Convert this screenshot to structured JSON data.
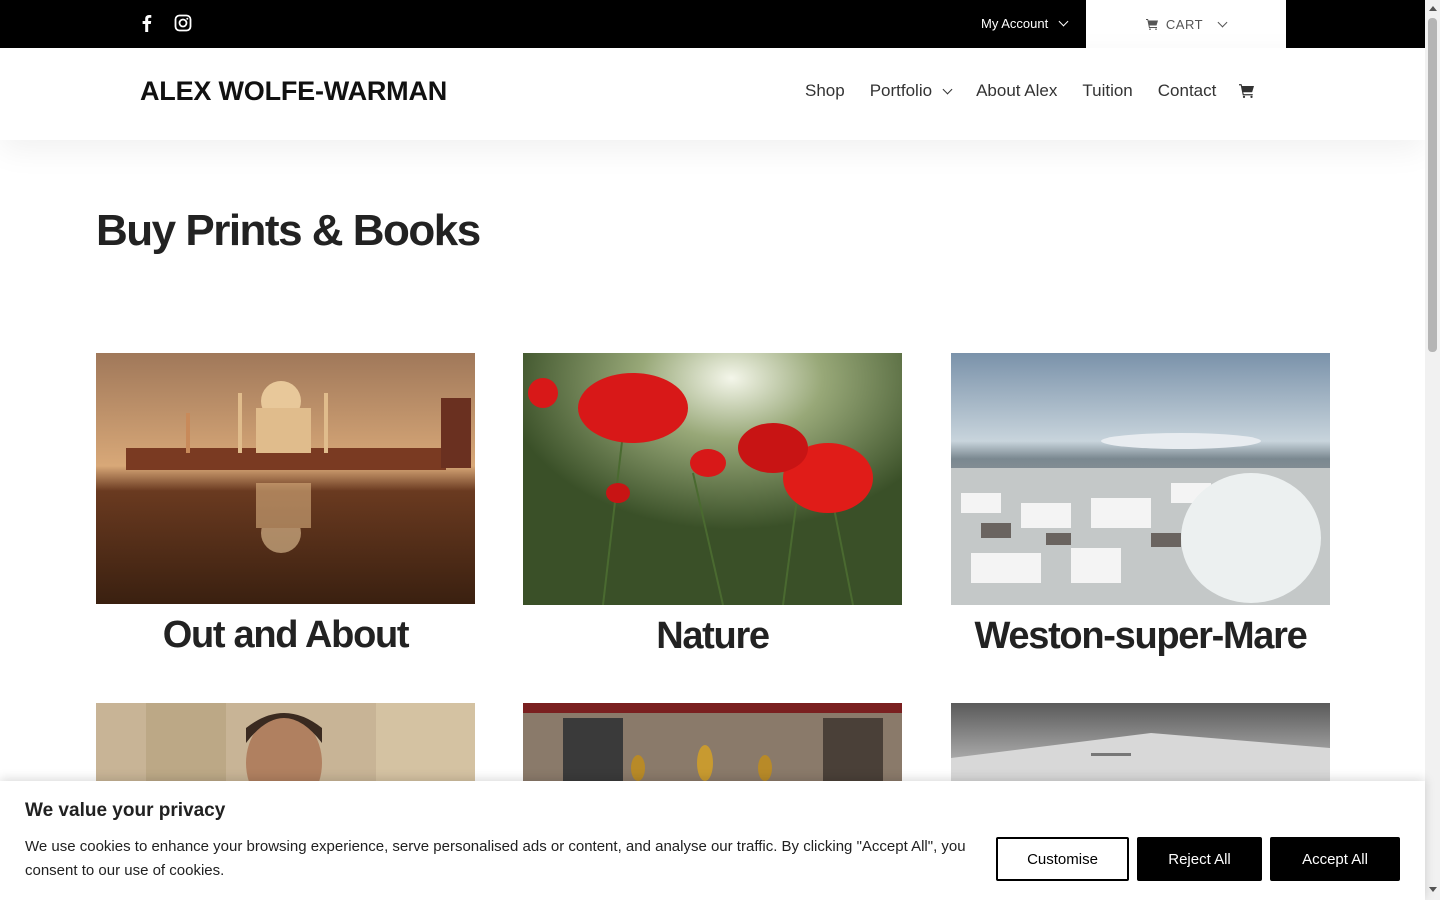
{
  "topbar": {
    "social": [
      {
        "icon": "facebook-icon"
      },
      {
        "icon": "instagram-icon"
      }
    ],
    "account_label": "My Account",
    "cart_label": "CART"
  },
  "header": {
    "logo": "ALEX WOLFE-WARMAN",
    "nav": [
      {
        "label": "Shop"
      },
      {
        "label": "Portfolio"
      },
      {
        "label": "About Alex"
      },
      {
        "label": "Tuition"
      },
      {
        "label": "Contact"
      }
    ],
    "cart_icon": "cart-icon"
  },
  "main": {
    "title": "Buy Prints & Books",
    "categories": [
      {
        "label": "Out and About",
        "image": "taj-mahal-photo"
      },
      {
        "label": "Nature",
        "image": "poppies-photo"
      },
      {
        "label": "Weston-super-Mare",
        "image": "snowy-town-photo"
      },
      {
        "label": "",
        "image": "portrait-photo"
      },
      {
        "label": "",
        "image": "buddha-shrine-photo"
      },
      {
        "label": "",
        "image": "book-photo"
      }
    ]
  },
  "cookie": {
    "title": "We value your privacy",
    "text": "We use cookies to enhance your browsing experience, serve personalised ads or content, and analyse our traffic. By clicking \"Accept All\", you consent to our use of cookies.",
    "customise": "Customise",
    "reject": "Reject All",
    "accept": "Accept All"
  }
}
